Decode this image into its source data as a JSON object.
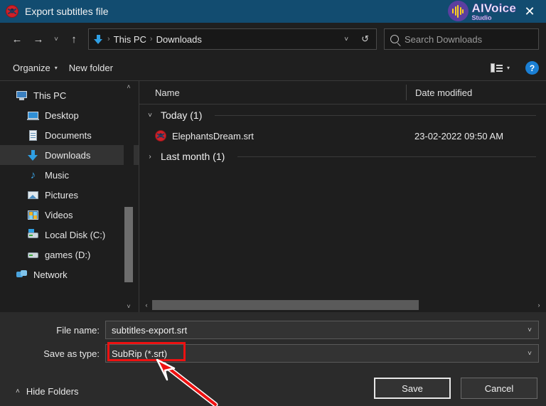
{
  "titlebar": {
    "app_icon": "vlc-cone-icon",
    "title": "Export subtitles file",
    "brand_name": "AIVoice",
    "brand_sub": "Studio",
    "close_label": "✕",
    "bg_color": "#124c70"
  },
  "nav": {
    "back": "←",
    "forward": "→",
    "recent": "˅",
    "up": "↑",
    "refresh": "↺",
    "dropdown": "˅",
    "breadcrumbs": [
      "This PC",
      "Downloads"
    ],
    "separator": "›"
  },
  "search": {
    "placeholder": "Search Downloads"
  },
  "toolbar": {
    "organize_label": "Organize",
    "organize_caret": "▾",
    "new_folder_label": "New folder",
    "view_caret": "▾",
    "help_label": "?"
  },
  "sidebar": {
    "items": [
      {
        "label": "This PC",
        "icon": "pc-icon",
        "indent": false,
        "selected": false
      },
      {
        "label": "Desktop",
        "icon": "desktop-icon",
        "indent": true,
        "selected": false
      },
      {
        "label": "Documents",
        "icon": "documents-icon",
        "indent": true,
        "selected": false
      },
      {
        "label": "Downloads",
        "icon": "downloads-icon",
        "indent": true,
        "selected": true
      },
      {
        "label": "Music",
        "icon": "music-icon",
        "indent": true,
        "selected": false
      },
      {
        "label": "Pictures",
        "icon": "pictures-icon",
        "indent": true,
        "selected": false
      },
      {
        "label": "Videos",
        "icon": "videos-icon",
        "indent": true,
        "selected": false
      },
      {
        "label": "Local Disk (C:)",
        "icon": "drive-windows-icon",
        "indent": true,
        "selected": false
      },
      {
        "label": "games (D:)",
        "icon": "drive-icon",
        "indent": true,
        "selected": false
      },
      {
        "label": "Network",
        "icon": "network-icon",
        "indent": false,
        "selected": false
      }
    ],
    "scroll_up": "˄",
    "scroll_down": "˅"
  },
  "filelist": {
    "columns": {
      "name": "Name",
      "date_modified": "Date modified"
    },
    "groups": [
      {
        "label": "Today (1)",
        "chevron": "˅",
        "expanded": true,
        "rows": [
          {
            "name": "ElephantsDream.srt",
            "date_modified": "23-02-2022 09:50 AM",
            "icon": "vlc-cone-icon"
          }
        ]
      },
      {
        "label": "Last month (1)",
        "chevron": "›",
        "expanded": false,
        "rows": []
      }
    ],
    "hscroll_left": "‹",
    "hscroll_right": "›"
  },
  "form": {
    "file_name_label": "File name:",
    "file_name_value": "subtitles-export.srt",
    "save_as_type_label": "Save as type:",
    "save_as_type_value": "SubRip (*.srt)",
    "combo_chevron": "˅"
  },
  "buttons": {
    "save": "Save",
    "cancel": "Cancel",
    "hide_folders": "Hide Folders",
    "hide_folders_chevron": "˄"
  },
  "annotations": {
    "highlight_color": "#ee1111",
    "highlight_target": "save-as-type-value",
    "arrow_color": "#ee1111"
  }
}
